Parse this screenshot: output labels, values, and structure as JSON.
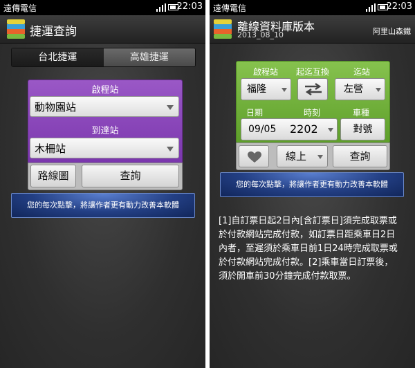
{
  "status": {
    "carrier": "遠傳電信",
    "time": "22:03"
  },
  "left": {
    "title": "捷運查詢",
    "tabs": [
      "台北捷運",
      "高雄捷運"
    ],
    "origin_label": "啟程站",
    "origin_value": "動物園站",
    "dest_label": "到達站",
    "dest_value": "木柵站",
    "map_button": "路線圖",
    "query_button": "查詢",
    "banner": "您的每次點擊，將讓作者更有動力改善本軟體"
  },
  "right": {
    "title": "離線資料庫版本",
    "subtitle": "2013_08_10",
    "link": "阿里山森鐵",
    "origin_label": "啟程站",
    "swap_label": "起迄互換",
    "dest_label": "迄站",
    "origin_value": "福隆",
    "dest_value": "左營",
    "date_label": "日期",
    "time_label": "時刻",
    "type_label": "車種",
    "date_value": "09/05",
    "time_value": "2202",
    "type_value": "對號",
    "mode_value": "線上",
    "query_button": "查詢",
    "banner": "您的每次點擊，將讓作者更有動力改善本軟體",
    "notice_lines": [
      "[1]自訂票日起2日內[含訂票日]須完成取票或",
      "於付款網站完成付款，如訂票日距乘車日2日",
      "內者，至遲須於乘車日前1日24時完成取票或",
      "於付款網站完成付款。[2]乘車當日訂票後，",
      "須於開車前30分鐘完成付款取票。"
    ]
  },
  "colors": {
    "purple_panel": "#8a45b9",
    "green_panel": "#6fb03a",
    "banner_blue": "#233f84"
  }
}
